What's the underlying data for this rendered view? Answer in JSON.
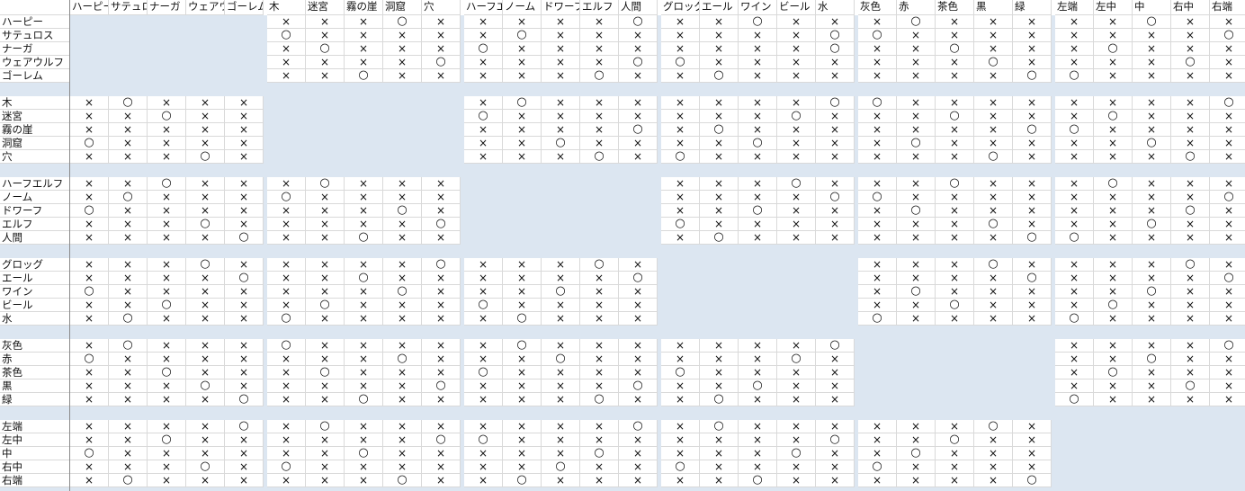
{
  "colors": {
    "block_fill": "#dce6f1",
    "gridline": "#d9d9d9",
    "text": "#111111"
  },
  "symbols": {
    "yes": "○",
    "no": "×"
  },
  "categories": [
    {
      "id": "race",
      "items": [
        "ハーピー",
        "サテュロス",
        "ナーガ",
        "ウェアウルフ",
        "ゴーレム"
      ]
    },
    {
      "id": "place",
      "items": [
        "木",
        "迷宮",
        "霧の崖",
        "洞窟",
        "穴"
      ]
    },
    {
      "id": "race2",
      "items": [
        "ハーフエルフ",
        "ノーム",
        "ドワーフ",
        "エルフ",
        "人間"
      ]
    },
    {
      "id": "drink",
      "items": [
        "グロッグ",
        "エール",
        "ワイン",
        "ビール",
        "水"
      ]
    },
    {
      "id": "color",
      "items": [
        "灰色",
        "赤",
        "茶色",
        "黒",
        "緑"
      ]
    },
    {
      "id": "pos",
      "items": [
        "左端",
        "左中",
        "中",
        "右中",
        "右端"
      ]
    }
  ],
  "column_headers": [
    "ハーピー",
    "サテュロス",
    "ナーガ",
    "ウェアウルフ",
    "ゴーレム",
    "木",
    "迷宮",
    "霧の崖",
    "洞窟",
    "穴",
    "ハーフエルフ",
    "ノーム",
    "ドワーフ",
    "エルフ",
    "人間",
    "グロッグ",
    "エール",
    "ワイン",
    "ビール",
    "水",
    "灰色",
    "赤",
    "茶色",
    "黒",
    "緑",
    "左端",
    "左中",
    "中",
    "右中",
    "右端"
  ],
  "row_groups": [
    {
      "labels": [
        "ハーピー",
        "サテュロス",
        "ナーガ",
        "ウェアウルフ",
        "ゴーレム"
      ],
      "blocks": [
        null,
        [
          "×××○×",
          "○××××",
          "×○×××",
          "××××○",
          "××○××"
        ],
        [
          "××××○",
          "×○×××",
          "○××××",
          "××××○",
          "×××○×"
        ],
        [
          "××○××",
          "××××○",
          "××××○",
          "○××××",
          "×○×××"
        ],
        [
          "×○×××",
          "○××××",
          "××○××",
          "×××○×",
          "××××○"
        ],
        [
          "××○××",
          "××××○",
          "×○×××",
          "×××○×",
          "○××××"
        ]
      ]
    },
    {
      "labels": [
        "木",
        "迷宮",
        "霧の崖",
        "洞窟",
        "穴"
      ],
      "blocks": [
        [
          "×○×××",
          "××○××",
          "×××××",
          "○××××",
          "×××○×"
        ],
        null,
        [
          "×○×××",
          "○××××",
          "××××○",
          "××○××",
          "×××○×"
        ],
        [
          "××××○",
          "×××○×",
          "×○×××",
          "××○××",
          "○××××"
        ],
        [
          "○××××",
          "××○××",
          "××××○",
          "×○×××",
          "×××○×"
        ],
        [
          "××××○",
          "×○×××",
          "○××××",
          "××○××",
          "×××○×"
        ]
      ]
    },
    {
      "labels": [
        "ハーフエルフ",
        "ノーム",
        "ドワーフ",
        "エルフ",
        "人間"
      ],
      "blocks": [
        [
          "××○××",
          "×○×××",
          "○××××",
          "×××○×",
          "××××○"
        ],
        [
          "×○×××",
          "○××××",
          "×××○×",
          "××××○",
          "××○××"
        ],
        null,
        [
          "×××○×",
          "××××○",
          "××○××",
          "○××××",
          "×○×××"
        ],
        [
          "××○××",
          "○××××",
          "×○×××",
          "×××○×",
          "××××○"
        ],
        [
          "×○×××",
          "××××○",
          "×××○×",
          "××○××",
          "○××××"
        ]
      ]
    },
    {
      "labels": [
        "グロッグ",
        "エール",
        "ワイン",
        "ビール",
        "水"
      ],
      "blocks": [
        [
          "×××○×",
          "××××○",
          "○××××",
          "××○××",
          "×○×××"
        ],
        [
          "××××○",
          "××○××",
          "×××○×",
          "×○×××",
          "○××××"
        ],
        [
          "×××○×",
          "××××○",
          "××○××",
          "○××××",
          "×○×××"
        ],
        null,
        [
          "×××○×",
          "××××○",
          "×○×××",
          "××○××",
          "○××××"
        ],
        [
          "×××○×",
          "××××○",
          "××○××",
          "×○×××",
          "○××××"
        ]
      ]
    },
    {
      "labels": [
        "灰色",
        "赤",
        "茶色",
        "黒",
        "緑"
      ],
      "blocks": [
        [
          "×○×××",
          "○××××",
          "××○××",
          "×××○×",
          "××××○"
        ],
        [
          "○××××",
          "×××○×",
          "×○×××",
          "××××○",
          "××○××"
        ],
        [
          "×○×××",
          "××○××",
          "○××××",
          "××××○",
          "×××○×"
        ],
        [
          "××××○",
          "×××○×",
          "○××××",
          "××○××",
          "×○×××"
        ],
        null,
        [
          "××××○",
          "××○××",
          "×○×××",
          "×××○×",
          "○××××"
        ]
      ]
    },
    {
      "labels": [
        "左端",
        "左中",
        "中",
        "右中",
        "右端"
      ],
      "blocks": [
        [
          "××××○",
          "××○××",
          "○××××",
          "×××○×",
          "×○×××"
        ],
        [
          "×○×××",
          "××××○",
          "××○××",
          "○××××",
          "×××○×"
        ],
        [
          "××××○",
          "○××××",
          "×××○×",
          "××○××",
          "×○×××"
        ],
        [
          "×○×××",
          "××××○",
          "×××○×",
          "○××××",
          "××○××"
        ],
        [
          "×××○×",
          "××○××",
          "×○×××",
          "○××××",
          "××××○"
        ],
        null
      ]
    }
  ]
}
